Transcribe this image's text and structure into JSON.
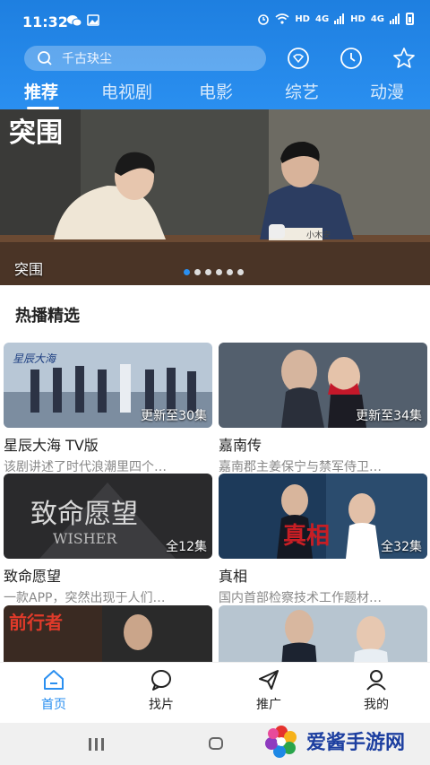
{
  "status": {
    "time": "11:32",
    "network_a": "HD",
    "network_b": "HD",
    "signal_a": "4G",
    "signal_b": "4G"
  },
  "search": {
    "placeholder": "千古玦尘"
  },
  "header_icons": [
    "vip-icon",
    "history-icon",
    "star-icon"
  ],
  "tabs": [
    {
      "label": "推荐",
      "active": true
    },
    {
      "label": "电视剧",
      "active": false
    },
    {
      "label": "电影",
      "active": false
    },
    {
      "label": "综艺",
      "active": false
    },
    {
      "label": "动漫",
      "active": false
    }
  ],
  "banner": {
    "logo_text": "突围",
    "caption": "突围",
    "dots": 6,
    "active_dot": 0,
    "nameplate": "小木安"
  },
  "section": {
    "title": "热播精选"
  },
  "cards": [
    {
      "title": "星辰大海 TV版",
      "desc": "该剧讲述了时代浪潮里四个…",
      "badge": "更新至30集",
      "poster_text": "星辰大海"
    },
    {
      "title": "嘉南传",
      "desc": "嘉南郡主姜保宁与禁军侍卫…",
      "badge": "更新至34集",
      "poster_text": ""
    },
    {
      "title": "致命愿望",
      "desc": "一款APP，突然出现于人们…",
      "badge": "全12集",
      "poster_text": "致命愿望",
      "poster_sub": "WISHER"
    },
    {
      "title": "真相",
      "desc": "国内首部检察技术工作题材…",
      "badge": "全32集",
      "poster_text": "真相"
    },
    {
      "title": "",
      "desc": "",
      "badge": "",
      "poster_text": "前行者"
    },
    {
      "title": "",
      "desc": "",
      "badge": "",
      "poster_text": ""
    }
  ],
  "bottom_nav": [
    {
      "label": "首页",
      "icon": "home-icon",
      "active": true
    },
    {
      "label": "找片",
      "icon": "chat-search-icon",
      "active": false
    },
    {
      "label": "推广",
      "icon": "send-icon",
      "active": false
    },
    {
      "label": "我的",
      "icon": "user-icon",
      "active": false
    }
  ],
  "watermark": {
    "text": "爱酱手游网"
  },
  "colors": {
    "accent": "#2a8ff0",
    "header": "#1e7fe0"
  }
}
